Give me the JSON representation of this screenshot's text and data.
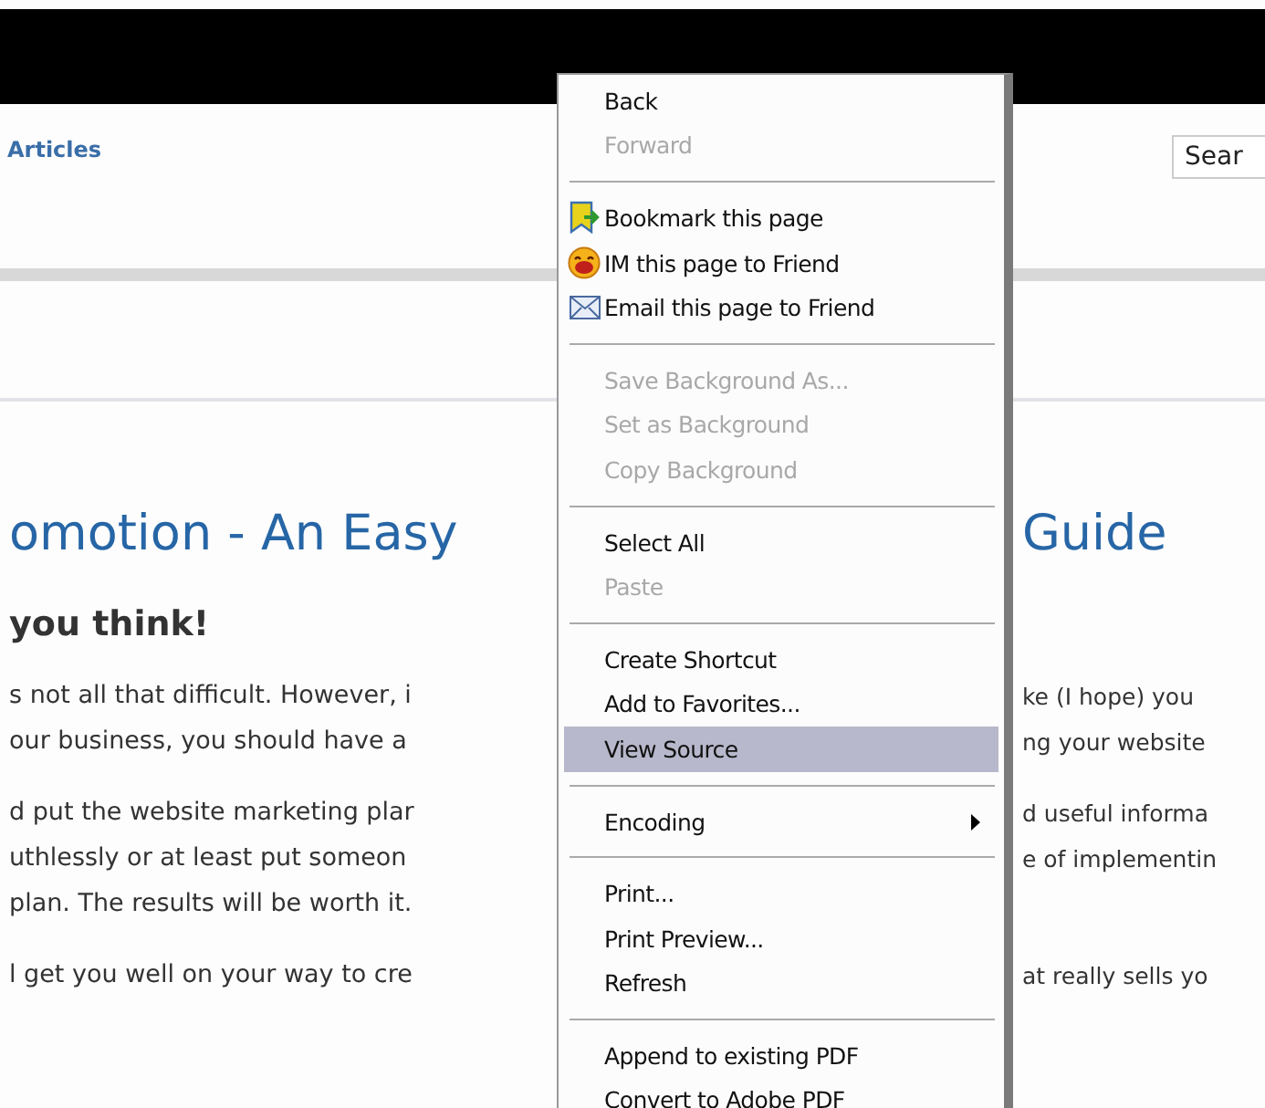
{
  "page": {
    "nav_link": "Articles",
    "search": {
      "value": "Sear"
    },
    "headline": {
      "left": "omotion - An Easy",
      "right": "Guide"
    },
    "subheading": "you think!",
    "paragraphs": [
      {
        "lines": [
          {
            "left": "s not all that difficult. However, i",
            "right": "ke (I hope) you"
          },
          {
            "left": "our business, you should have a",
            "right": "ng your website"
          }
        ]
      },
      {
        "lines": [
          {
            "left": "d put the website marketing plar",
            "right": "d useful informa"
          },
          {
            "left": "uthlessly or at least put someon",
            "right": "e of implementin"
          },
          {
            "left": "plan. The results will be worth it."
          }
        ]
      },
      {
        "lines": [
          {
            "left": "l get you well on your way to cre",
            "right": "at really sells yo"
          }
        ]
      }
    ]
  },
  "context_menu": {
    "items": [
      {
        "kind": "item",
        "label": "Back",
        "disabled": false,
        "selected": false
      },
      {
        "kind": "item",
        "label": "Forward",
        "disabled": true,
        "selected": false
      },
      {
        "kind": "separator"
      },
      {
        "kind": "icon_item",
        "label": "Bookmark this page",
        "disabled": false,
        "selected": false
      },
      {
        "kind": "icon_item",
        "label": "IM this page to Friend",
        "disabled": false,
        "selected": false
      },
      {
        "kind": "icon_item",
        "label": "Email this page to Friend",
        "disabled": false,
        "selected": false
      },
      {
        "kind": "separator"
      },
      {
        "kind": "item",
        "label": "Save Background As...",
        "disabled": true,
        "selected": false
      },
      {
        "kind": "item",
        "label": "Set as Background",
        "disabled": true,
        "selected": false
      },
      {
        "kind": "item",
        "label": "Copy Background",
        "disabled": true,
        "selected": false
      },
      {
        "kind": "separator"
      },
      {
        "kind": "item",
        "label": "Select All",
        "disabled": false,
        "selected": false
      },
      {
        "kind": "item",
        "label": "Paste",
        "disabled": true,
        "selected": false
      },
      {
        "kind": "separator"
      },
      {
        "kind": "item",
        "label": "Create Shortcut",
        "disabled": false,
        "selected": false
      },
      {
        "kind": "item",
        "label": "Add to Favorites...",
        "disabled": false,
        "selected": false
      },
      {
        "kind": "item",
        "label": "View Source",
        "disabled": false,
        "selected": true
      },
      {
        "kind": "separator"
      },
      {
        "kind": "submenu",
        "label": "Encoding",
        "disabled": false,
        "selected": false
      },
      {
        "kind": "separator"
      },
      {
        "kind": "item",
        "label": "Print...",
        "disabled": false,
        "selected": false
      },
      {
        "kind": "item",
        "label": "Print Preview...",
        "disabled": false,
        "selected": false
      },
      {
        "kind": "item",
        "label": "Refresh",
        "disabled": false,
        "selected": false
      },
      {
        "kind": "separator"
      },
      {
        "kind": "item",
        "label": "Append to existing PDF",
        "disabled": false,
        "selected": false
      },
      {
        "kind": "item",
        "label": "Convert to Adobe PDF",
        "disabled": false,
        "selected": false
      }
    ]
  }
}
